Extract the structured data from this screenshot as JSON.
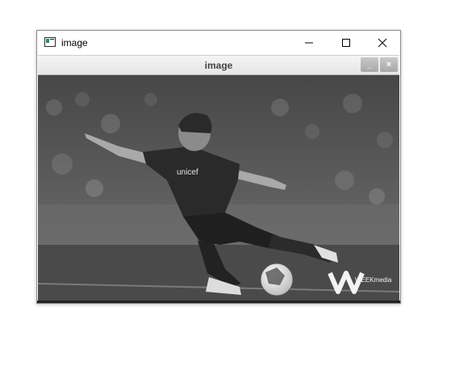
{
  "window": {
    "title": "image",
    "icon": "opencv-window-icon",
    "controls": {
      "minimize": "minimize-icon",
      "maximize": "maximize-icon",
      "close": "close-icon"
    }
  },
  "inner_header": {
    "title": "image",
    "minimize_label": "_",
    "close_label": "×"
  },
  "image": {
    "description_colors": {
      "background": "#555555"
    },
    "shirt_text": "unicef",
    "watermark": "WEEKmedia"
  }
}
